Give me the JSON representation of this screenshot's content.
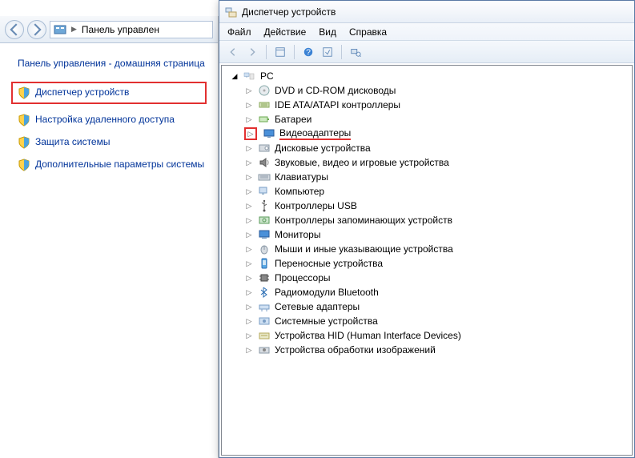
{
  "controlPanel": {
    "breadcrumb": "Панель управлен",
    "heading": "Панель управления - домашняя страница",
    "links": {
      "deviceManager": "Диспетчер устройств",
      "remoteAccess": "Настройка удаленного доступа",
      "systemProtection": "Защита системы",
      "advancedSystem": "Дополнительные параметры системы"
    }
  },
  "deviceManager": {
    "title": "Диспетчер устройств",
    "menu": {
      "file": "Файл",
      "action": "Действие",
      "view": "Вид",
      "help": "Справка"
    },
    "rootNode": "PC",
    "categories": [
      {
        "label": "DVD и CD-ROM дисководы",
        "icon": "optical"
      },
      {
        "label": "IDE ATA/ATAPI контроллеры",
        "icon": "ide"
      },
      {
        "label": "Батареи",
        "icon": "battery"
      },
      {
        "label": "Видеоадаптеры",
        "icon": "display",
        "highlighted": true
      },
      {
        "label": "Дисковые устройства",
        "icon": "disk"
      },
      {
        "label": "Звуковые, видео и игровые устройства",
        "icon": "sound"
      },
      {
        "label": "Клавиатуры",
        "icon": "keyboard"
      },
      {
        "label": "Компьютер",
        "icon": "computer"
      },
      {
        "label": "Контроллеры USB",
        "icon": "usb"
      },
      {
        "label": "Контроллеры запоминающих устройств",
        "icon": "storage"
      },
      {
        "label": "Мониторы",
        "icon": "monitor"
      },
      {
        "label": "Мыши и иные указывающие устройства",
        "icon": "mouse"
      },
      {
        "label": "Переносные устройства",
        "icon": "portable"
      },
      {
        "label": "Процессоры",
        "icon": "cpu"
      },
      {
        "label": "Радиомодули Bluetooth",
        "icon": "bluetooth"
      },
      {
        "label": "Сетевые адаптеры",
        "icon": "network"
      },
      {
        "label": "Системные устройства",
        "icon": "system"
      },
      {
        "label": "Устройства HID (Human Interface Devices)",
        "icon": "hid"
      },
      {
        "label": "Устройства обработки изображений",
        "icon": "imaging"
      }
    ]
  }
}
